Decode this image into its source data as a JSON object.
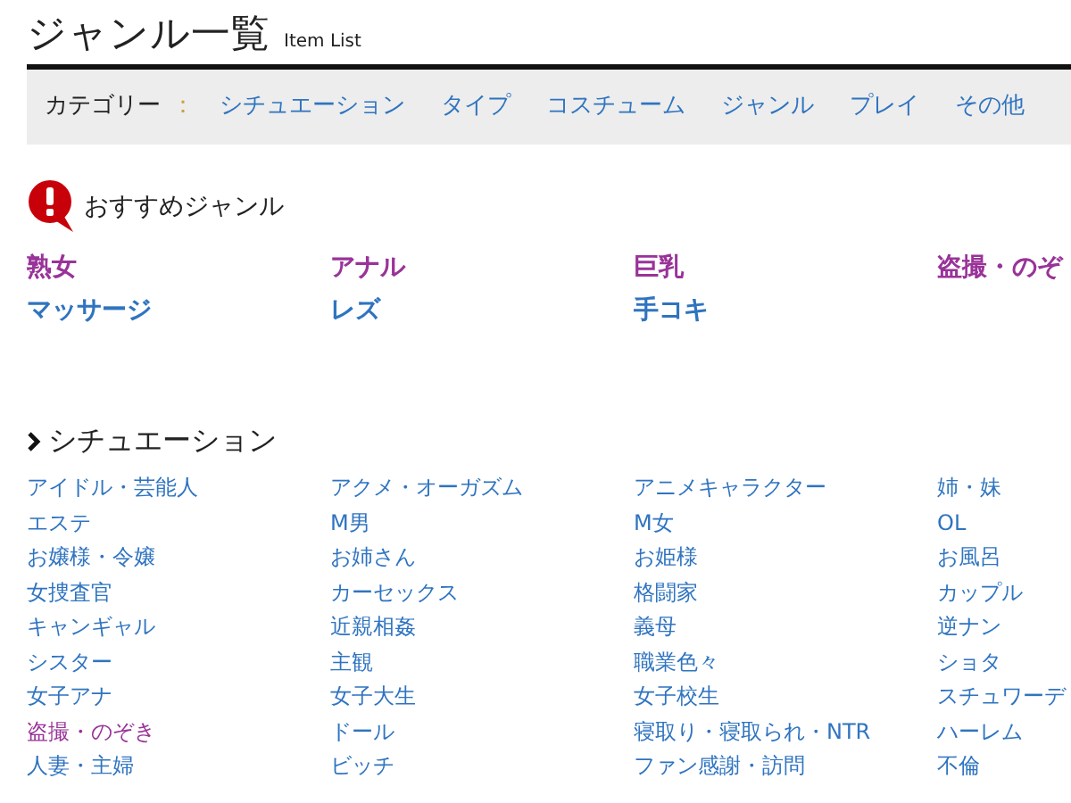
{
  "header": {
    "title": "ジャンル一覧",
    "subtitle": "Item List"
  },
  "category_bar": {
    "label": "カテゴリー",
    "separator": "：",
    "links": [
      "シチュエーション",
      "タイプ",
      "コスチューム",
      "ジャンル",
      "プレイ",
      "その他"
    ]
  },
  "recommended": {
    "title": "おすすめジャンル",
    "items": [
      {
        "label": "熟女",
        "visited": true
      },
      {
        "label": "アナル",
        "visited": true
      },
      {
        "label": "巨乳",
        "visited": true
      },
      {
        "label": "盗撮・のぞ",
        "visited": true
      },
      {
        "label": "マッサージ",
        "visited": false
      },
      {
        "label": "レズ",
        "visited": false
      },
      {
        "label": "手コキ",
        "visited": false
      }
    ]
  },
  "sections": [
    {
      "title": "シチュエーション",
      "items": [
        {
          "label": "アイドル・芸能人",
          "visited": false
        },
        {
          "label": "アクメ・オーガズム",
          "visited": false
        },
        {
          "label": "アニメキャラクター",
          "visited": false
        },
        {
          "label": "姉・妹",
          "visited": false
        },
        {
          "label": "エステ",
          "visited": false
        },
        {
          "label": "M男",
          "visited": false
        },
        {
          "label": "M女",
          "visited": false
        },
        {
          "label": "OL",
          "visited": false
        },
        {
          "label": "お嬢様・令嬢",
          "visited": false
        },
        {
          "label": "お姉さん",
          "visited": false
        },
        {
          "label": "お姫様",
          "visited": false
        },
        {
          "label": "お風呂",
          "visited": false
        },
        {
          "label": "女捜査官",
          "visited": false
        },
        {
          "label": "カーセックス",
          "visited": false
        },
        {
          "label": "格闘家",
          "visited": false
        },
        {
          "label": "カップル",
          "visited": false
        },
        {
          "label": "キャンギャル",
          "visited": false
        },
        {
          "label": "近親相姦",
          "visited": false
        },
        {
          "label": "義母",
          "visited": false
        },
        {
          "label": "逆ナン",
          "visited": false
        },
        {
          "label": "シスター",
          "visited": false
        },
        {
          "label": "主観",
          "visited": false
        },
        {
          "label": "職業色々",
          "visited": false
        },
        {
          "label": "ショタ",
          "visited": false
        },
        {
          "label": "女子アナ",
          "visited": false
        },
        {
          "label": "女子大生",
          "visited": false
        },
        {
          "label": "女子校生",
          "visited": false
        },
        {
          "label": "スチュワーデ",
          "visited": false
        },
        {
          "label": "盗撮・のぞき",
          "visited": true
        },
        {
          "label": "ドール",
          "visited": false
        },
        {
          "label": "寝取り・寝取られ・NTR",
          "visited": false
        },
        {
          "label": "ハーレム",
          "visited": false
        },
        {
          "label": "人妻・主婦",
          "visited": false
        },
        {
          "label": "ビッチ",
          "visited": false
        },
        {
          "label": "ファン感謝・訪問",
          "visited": false
        },
        {
          "label": "不倫",
          "visited": false
        }
      ]
    }
  ]
}
